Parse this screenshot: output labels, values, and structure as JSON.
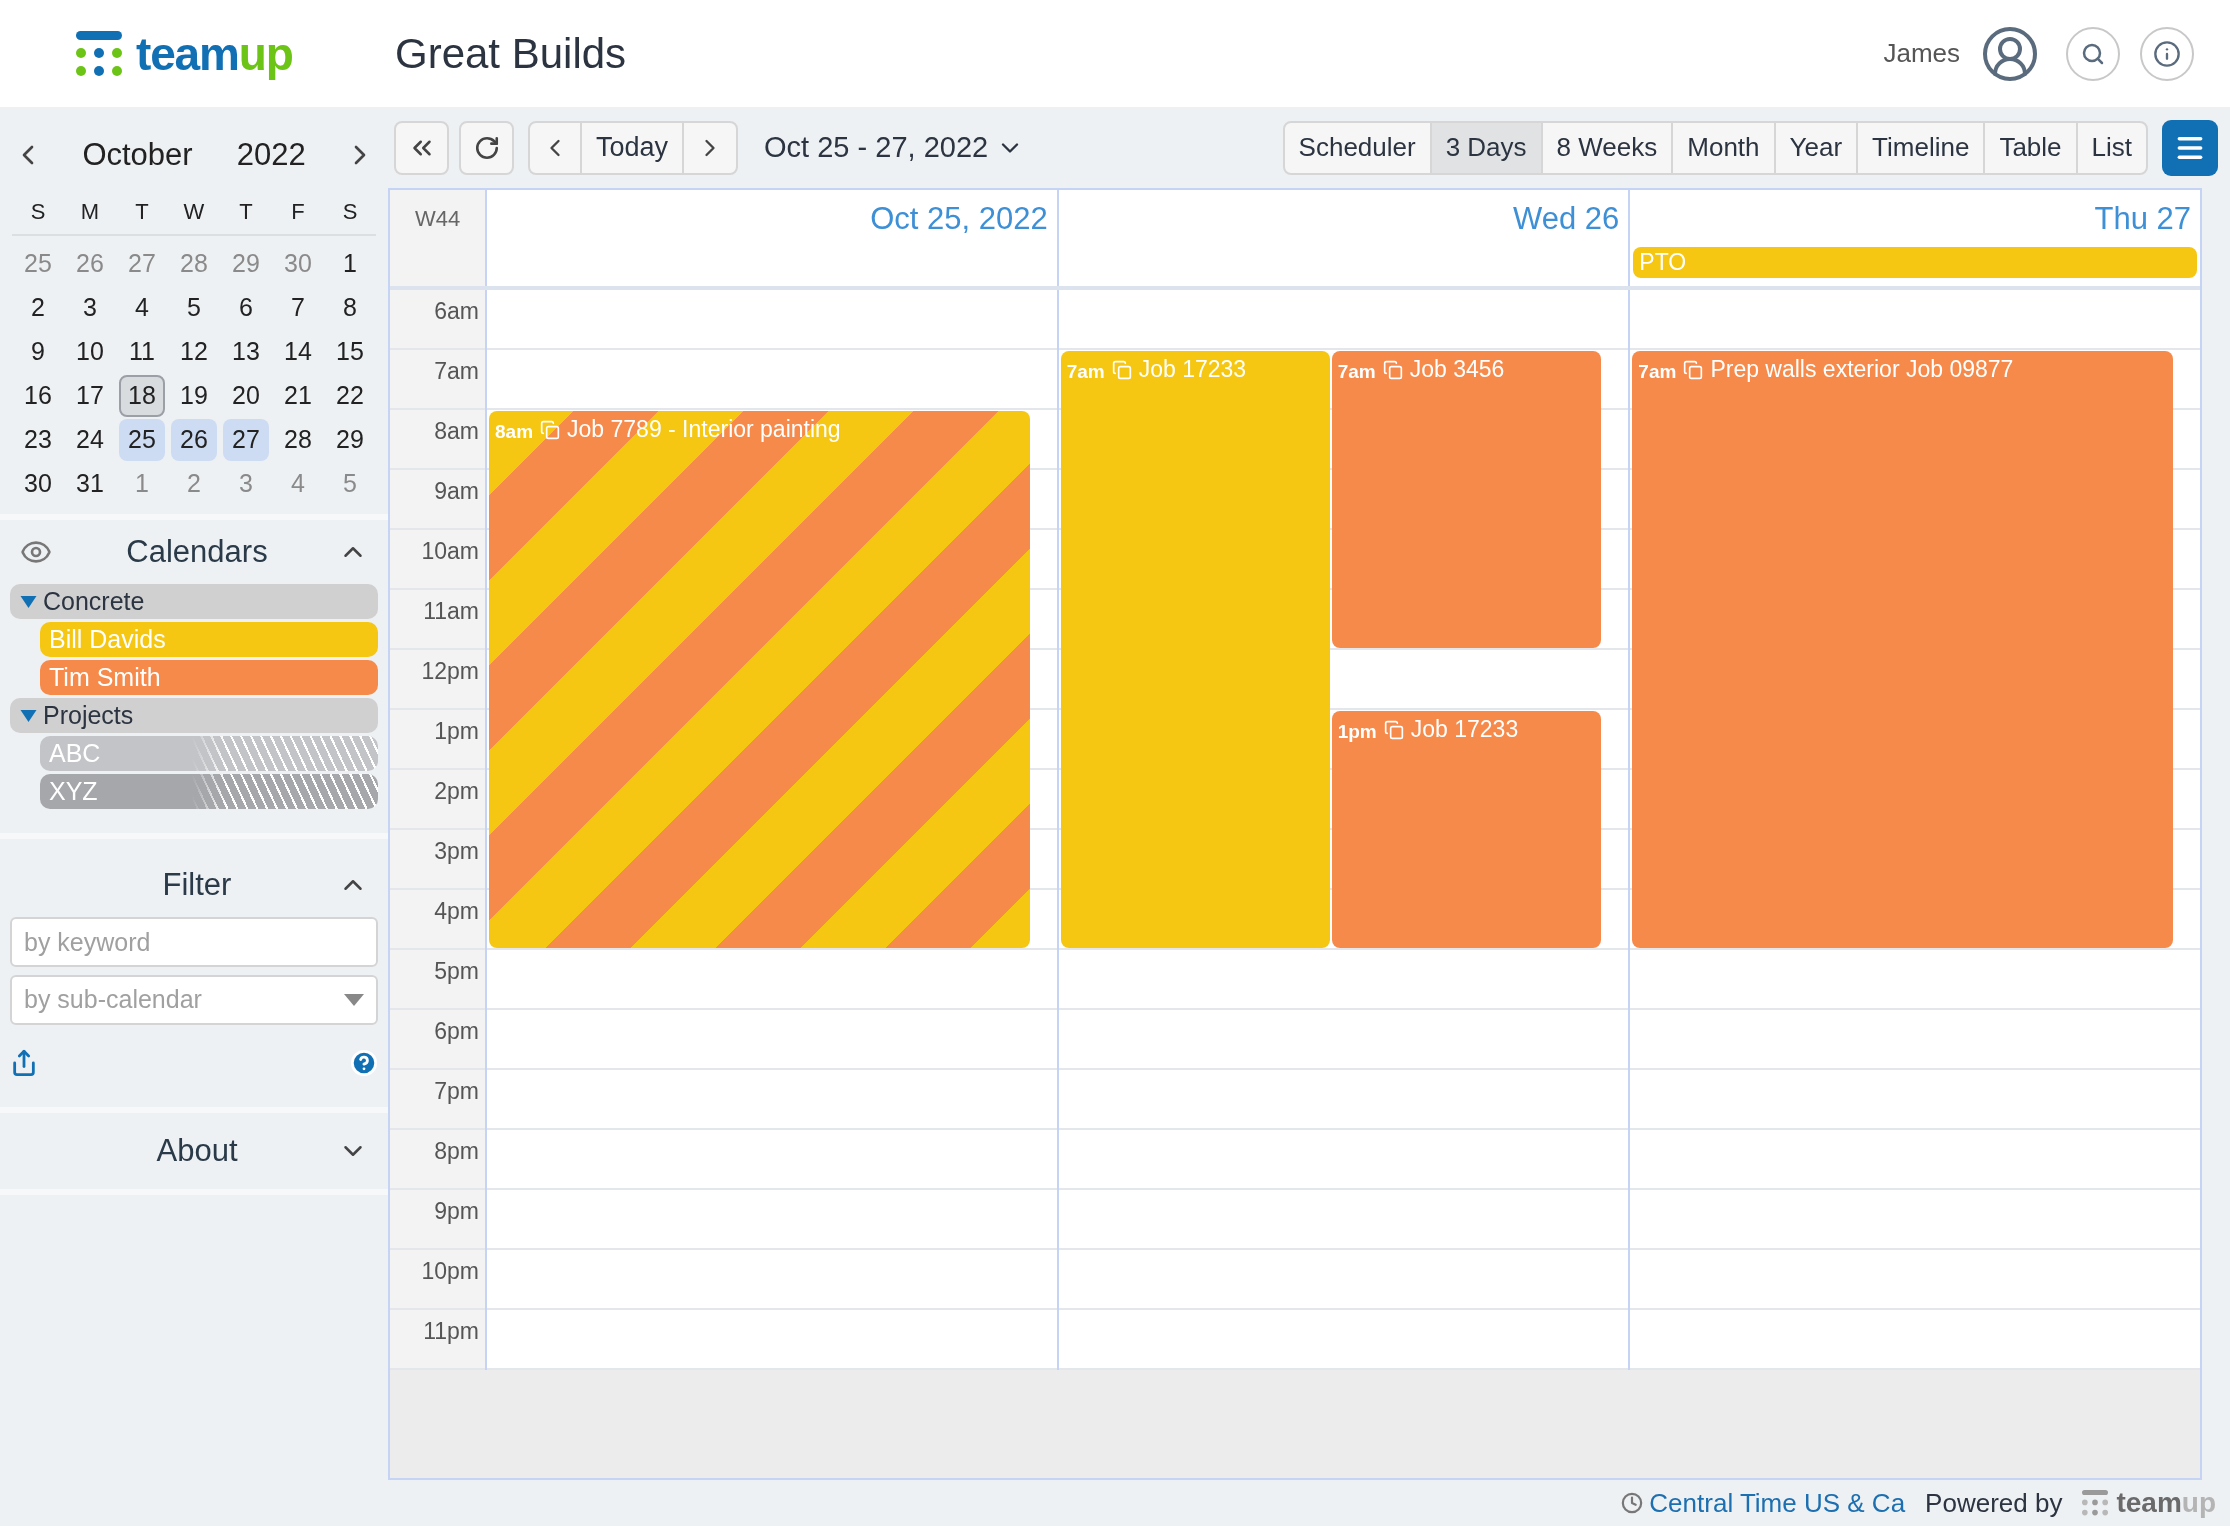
{
  "header": {
    "logo": [
      "team",
      "up"
    ],
    "title": "Great Builds",
    "user": "James"
  },
  "mini_calendar": {
    "month": "October",
    "year": "2022",
    "weekdays": [
      "S",
      "M",
      "T",
      "W",
      "T",
      "F",
      "S"
    ],
    "weeks": [
      [
        {
          "label": "25",
          "other_month": true,
          "today": false,
          "selected": false
        },
        {
          "label": "26",
          "other_month": true,
          "today": false,
          "selected": false
        },
        {
          "label": "27",
          "other_month": true,
          "today": false,
          "selected": false
        },
        {
          "label": "28",
          "other_month": true,
          "today": false,
          "selected": false
        },
        {
          "label": "29",
          "other_month": true,
          "today": false,
          "selected": false
        },
        {
          "label": "30",
          "other_month": true,
          "today": false,
          "selected": false
        },
        {
          "label": "1",
          "other_month": false,
          "today": false,
          "selected": false
        }
      ],
      [
        {
          "label": "2",
          "other_month": false,
          "today": false,
          "selected": false
        },
        {
          "label": "3",
          "other_month": false,
          "today": false,
          "selected": false
        },
        {
          "label": "4",
          "other_month": false,
          "today": false,
          "selected": false
        },
        {
          "label": "5",
          "other_month": false,
          "today": false,
          "selected": false
        },
        {
          "label": "6",
          "other_month": false,
          "today": false,
          "selected": false
        },
        {
          "label": "7",
          "other_month": false,
          "today": false,
          "selected": false
        },
        {
          "label": "8",
          "other_month": false,
          "today": false,
          "selected": false
        }
      ],
      [
        {
          "label": "9",
          "other_month": false,
          "today": false,
          "selected": false
        },
        {
          "label": "10",
          "other_month": false,
          "today": false,
          "selected": false
        },
        {
          "label": "11",
          "other_month": false,
          "today": false,
          "selected": false
        },
        {
          "label": "12",
          "other_month": false,
          "today": false,
          "selected": false
        },
        {
          "label": "13",
          "other_month": false,
          "today": false,
          "selected": false
        },
        {
          "label": "14",
          "other_month": false,
          "today": false,
          "selected": false
        },
        {
          "label": "15",
          "other_month": false,
          "today": false,
          "selected": false
        }
      ],
      [
        {
          "label": "16",
          "other_month": false,
          "today": false,
          "selected": false
        },
        {
          "label": "17",
          "other_month": false,
          "today": false,
          "selected": false
        },
        {
          "label": "18",
          "other_month": false,
          "today": true,
          "selected": false
        },
        {
          "label": "19",
          "other_month": false,
          "today": false,
          "selected": false
        },
        {
          "label": "20",
          "other_month": false,
          "today": false,
          "selected": false
        },
        {
          "label": "21",
          "other_month": false,
          "today": false,
          "selected": false
        },
        {
          "label": "22",
          "other_month": false,
          "today": false,
          "selected": false
        }
      ],
      [
        {
          "label": "23",
          "other_month": false,
          "today": false,
          "selected": false
        },
        {
          "label": "24",
          "other_month": false,
          "today": false,
          "selected": false
        },
        {
          "label": "25",
          "other_month": false,
          "today": false,
          "selected": true
        },
        {
          "label": "26",
          "other_month": false,
          "today": false,
          "selected": true
        },
        {
          "label": "27",
          "other_month": false,
          "today": false,
          "selected": true
        },
        {
          "label": "28",
          "other_month": false,
          "today": false,
          "selected": false
        },
        {
          "label": "29",
          "other_month": false,
          "today": false,
          "selected": false
        }
      ],
      [
        {
          "label": "30",
          "other_month": false,
          "today": false,
          "selected": false
        },
        {
          "label": "31",
          "other_month": false,
          "today": false,
          "selected": false
        },
        {
          "label": "1",
          "other_month": true,
          "today": false,
          "selected": false
        },
        {
          "label": "2",
          "other_month": true,
          "today": false,
          "selected": false
        },
        {
          "label": "3",
          "other_month": true,
          "today": false,
          "selected": false
        },
        {
          "label": "4",
          "other_month": true,
          "today": false,
          "selected": false
        },
        {
          "label": "5",
          "other_month": true,
          "today": false,
          "selected": false
        }
      ]
    ]
  },
  "calendars": {
    "title": "Calendars",
    "expanded": true,
    "groups": [
      {
        "name": "Concrete",
        "expanded": true,
        "children": [
          {
            "name": "Bill Davids",
            "color": "#f5c712",
            "hidden": false
          },
          {
            "name": "Tim Smith",
            "color": "#f58a4b",
            "hidden": false
          }
        ]
      },
      {
        "name": "Projects",
        "expanded": true,
        "children": [
          {
            "name": "ABC",
            "color": "#c3c4c7",
            "hidden": true
          },
          {
            "name": "XYZ",
            "color": "#a6a7aa",
            "hidden": true
          }
        ]
      }
    ]
  },
  "filter": {
    "title": "Filter",
    "expanded": true,
    "keyword_placeholder": "by keyword",
    "subcalendar_placeholder": "by sub-calendar"
  },
  "about": {
    "title": "About",
    "expanded": false
  },
  "toolbar": {
    "today": "Today",
    "date_range": "Oct 25 - 27, 2022",
    "views": [
      {
        "label": "Scheduler",
        "selected": false
      },
      {
        "label": "3 Days",
        "selected": true
      },
      {
        "label": "8 Weeks",
        "selected": false
      },
      {
        "label": "Month",
        "selected": false
      },
      {
        "label": "Year",
        "selected": false
      },
      {
        "label": "Timeline",
        "selected": false
      },
      {
        "label": "Table",
        "selected": false
      },
      {
        "label": "List",
        "selected": false
      }
    ]
  },
  "grid": {
    "week": "W44",
    "days": [
      {
        "label": "Oct 25, 2022",
        "events": [
          {
            "start": "8am",
            "kind": "nine",
            "lane": {
              "kind": "full"
            },
            "title": "Job 7789 - Interior painting",
            "color": "#f5c712",
            "stripe": {
              "color": "#f58a4b"
            }
          }
        ]
      },
      {
        "label": "Wed 26",
        "events": [
          {
            "start": "7am",
            "kind": "ten",
            "lane": {
              "kind": "left"
            },
            "title": "Job 17233",
            "color": "#f5c712"
          },
          {
            "start": "7am",
            "kind": "five",
            "lane": {
              "kind": "right"
            },
            "title": "Job 3456",
            "color": "#f58a4b"
          },
          {
            "start": "1pm",
            "kind": "four",
            "lane": {
              "kind": "right"
            },
            "title": "Job 17233",
            "color": "#f58a4b"
          }
        ]
      },
      {
        "label": "Thu 27",
        "all_day": [
          {
            "title": "PTO",
            "color": "#f5c712"
          }
        ],
        "events": [
          {
            "start": "7am",
            "kind": "ten",
            "lane": {
              "kind": "full"
            },
            "title": "Prep walls exterior Job 09877",
            "color": "#f58a4b"
          }
        ]
      }
    ],
    "hours": [
      "6am",
      "7am",
      "8am",
      "9am",
      "10am",
      "11am",
      "12pm",
      "1pm",
      "2pm",
      "3pm",
      "4pm",
      "5pm",
      "6pm",
      "7pm",
      "8pm",
      "9pm",
      "10pm",
      "11pm"
    ]
  },
  "footer": {
    "timezone": "Central Time US & Ca",
    "powered_by": "Powered by",
    "logo": [
      "team",
      "up"
    ]
  }
}
